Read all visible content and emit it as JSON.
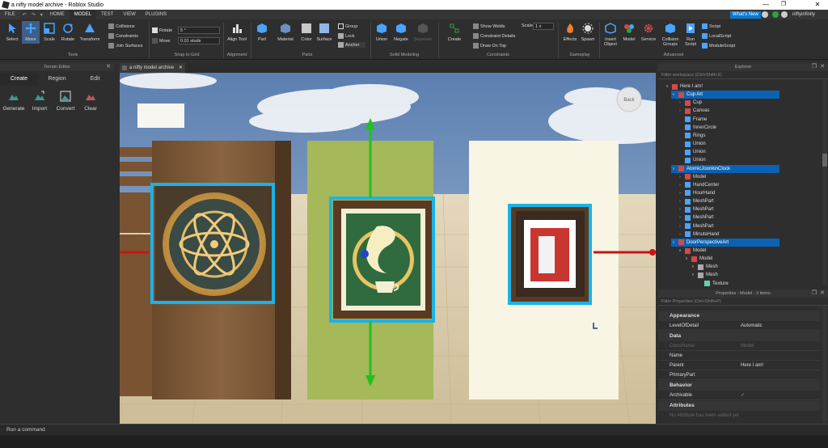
{
  "window": {
    "title": "a nifty model archive - Roblox Studio"
  },
  "menu": {
    "file": "FILE",
    "tabs": [
      "HOME",
      "MODEL",
      "TEST",
      "VIEW",
      "PLUGINS"
    ],
    "active": "MODEL",
    "whats_new": "What's New",
    "user": "niftyinfinity"
  },
  "ribbon": {
    "tools": {
      "select": "Select",
      "move": "Move",
      "scale": "Scale",
      "rotate": "Rotate",
      "transform": "Transform",
      "label": "Tools"
    },
    "collisions": {
      "collisions": "Collisions",
      "constraints": "Constraints",
      "join": "Join Surfaces"
    },
    "snap": {
      "rotate": "Rotate",
      "rotate_value": "5 °",
      "move": "Move",
      "move_value": "0.01 studs",
      "label": "Snap to Grid"
    },
    "alignment": {
      "align": "Align Tool",
      "label": "Alignment"
    },
    "parts": {
      "part": "Part",
      "material": "Material",
      "color": "Color",
      "surface": "Surface",
      "group": "Group",
      "lock": "Lock",
      "anchor": "Anchor",
      "label": "Parts"
    },
    "solid": {
      "union": "Union",
      "negate": "Negate",
      "separate": "Separate",
      "label": "Solid Modeling"
    },
    "constraints": {
      "create": "Create",
      "show_welds": "Show Welds",
      "details": "Constraint Details",
      "draw_on_top": "Draw On Top",
      "scale": "Scale",
      "scale_value": "1 x",
      "label": "Constraints"
    },
    "gameplay": {
      "effects": "Effects",
      "spawn": "Spawn",
      "label": "Gameplay"
    },
    "advanced": {
      "insert": "Insert Object",
      "model": "Model",
      "service": "Service",
      "collision_groups": "Collision Groups",
      "run_script": "Run Script",
      "script": "Script",
      "local_script": "LocalScript",
      "module_script": "ModuleScript",
      "label": "Advanced"
    }
  },
  "terrain": {
    "header": "Terrain Editor",
    "tabs": [
      "Create",
      "Region",
      "Edit"
    ],
    "tools": [
      "Generate",
      "Import",
      "Convert",
      "Clear"
    ]
  },
  "document_tab": "a nifty model archive",
  "viewport": {
    "back": "Back"
  },
  "explorer": {
    "header": "Explorer",
    "filter": "Filter workspace (Ctrl+Shift+X)",
    "items": [
      "Here I am!",
      "Cup Art",
      "Cup",
      "Canvas",
      "Frame",
      "InnerCircle",
      "Rings",
      "Union",
      "Union",
      "Union",
      "AtomicJoonkinClock",
      "Model",
      "HandCenter",
      "HourHand",
      "MeshPart",
      "MeshPart",
      "MeshPart",
      "MeshPart",
      "MinuteHand",
      "DoorPerspectiveArt",
      "Model",
      "Model",
      "Mesh",
      "Mesh",
      "Texture"
    ]
  },
  "properties": {
    "header": "Properties - Model - 3 items",
    "filter": "Filter Properties (Ctrl+Shift+P)",
    "cat_appearance": "Appearance",
    "level_of_detail": "LevelOfDetail",
    "lod_value": "Automatic",
    "cat_data": "Data",
    "classname": "ClassName",
    "classname_value": "Model",
    "name": "Name",
    "parent": "Parent",
    "parent_value": "Here I am!",
    "primary_part": "PrimaryPart",
    "cat_behavior": "Behavior",
    "archivable": "Archivable",
    "cat_attributes": "Attributes",
    "no_attributes": "No Attribute has been added yet"
  },
  "command": "Run a command",
  "colors": {
    "accent": "#0b62b4",
    "selection": "#1ab3e6",
    "move_green": "#1ec21e",
    "move_red": "#c81414"
  }
}
